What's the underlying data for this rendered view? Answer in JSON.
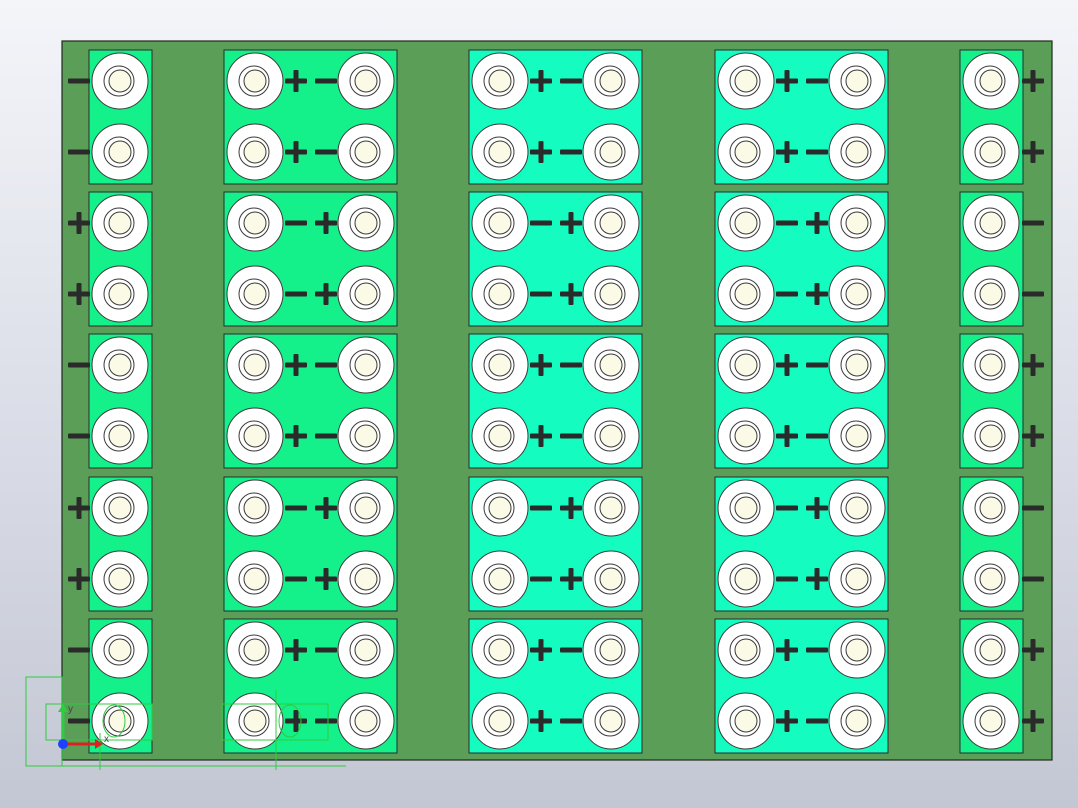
{
  "viewport": {
    "title": "",
    "colors": {
      "board": "#5a9e57",
      "module_fill_a": "#14f08a",
      "module_fill_b": "#14fcc0",
      "terminal": "#ffffff",
      "terminal_core": "#fbfae6",
      "polarity_mark": "#2a2a2a",
      "selection": "#2ecc40"
    },
    "axis_triad": {
      "x_label": "x",
      "y_label": "y",
      "x_color": "#e02020",
      "y_color": "#2ecc40",
      "z_color": "#1e40ff"
    },
    "module_columns": [
      {
        "name": "left-edge",
        "kind": "single",
        "modules": [
          {
            "fill": "a",
            "marks": [
              "-",
              "-"
            ]
          },
          {
            "fill": "a",
            "marks": [
              "+",
              "+"
            ]
          },
          {
            "fill": "a",
            "marks": [
              "-",
              "-"
            ]
          },
          {
            "fill": "a",
            "marks": [
              "+",
              "+"
            ]
          },
          {
            "fill": "a",
            "marks": [
              "-",
              "-"
            ]
          }
        ]
      },
      {
        "name": "column-1",
        "kind": "double",
        "modules": [
          {
            "fill": "a",
            "marks": [
              "+-",
              "+-"
            ]
          },
          {
            "fill": "a",
            "marks": [
              "-+",
              "-+"
            ]
          },
          {
            "fill": "a",
            "marks": [
              "+-",
              "+-"
            ]
          },
          {
            "fill": "a",
            "marks": [
              "-+",
              "-+"
            ]
          },
          {
            "fill": "a",
            "marks": [
              "+-",
              "+-"
            ]
          }
        ]
      },
      {
        "name": "column-2",
        "kind": "double",
        "modules": [
          {
            "fill": "b",
            "marks": [
              "+-",
              "+-"
            ]
          },
          {
            "fill": "b",
            "marks": [
              "-+",
              "-+"
            ]
          },
          {
            "fill": "b",
            "marks": [
              "+-",
              "+-"
            ]
          },
          {
            "fill": "b",
            "marks": [
              "-+",
              "-+"
            ]
          },
          {
            "fill": "b",
            "marks": [
              "+-",
              "+-"
            ]
          }
        ]
      },
      {
        "name": "column-3",
        "kind": "double",
        "modules": [
          {
            "fill": "b",
            "marks": [
              "+-",
              "+-"
            ]
          },
          {
            "fill": "b",
            "marks": [
              "-+",
              "-+"
            ]
          },
          {
            "fill": "b",
            "marks": [
              "+-",
              "+-"
            ]
          },
          {
            "fill": "b",
            "marks": [
              "-+",
              "-+"
            ]
          },
          {
            "fill": "b",
            "marks": [
              "+-",
              "+-"
            ]
          }
        ]
      },
      {
        "name": "right-edge",
        "kind": "single",
        "modules": [
          {
            "fill": "a",
            "marks": [
              "+",
              "+"
            ]
          },
          {
            "fill": "a",
            "marks": [
              "-",
              "-"
            ]
          },
          {
            "fill": "a",
            "marks": [
              "+",
              "+"
            ]
          },
          {
            "fill": "a",
            "marks": [
              "-",
              "-"
            ]
          },
          {
            "fill": "a",
            "marks": [
              "+",
              "+"
            ]
          }
        ]
      }
    ]
  }
}
